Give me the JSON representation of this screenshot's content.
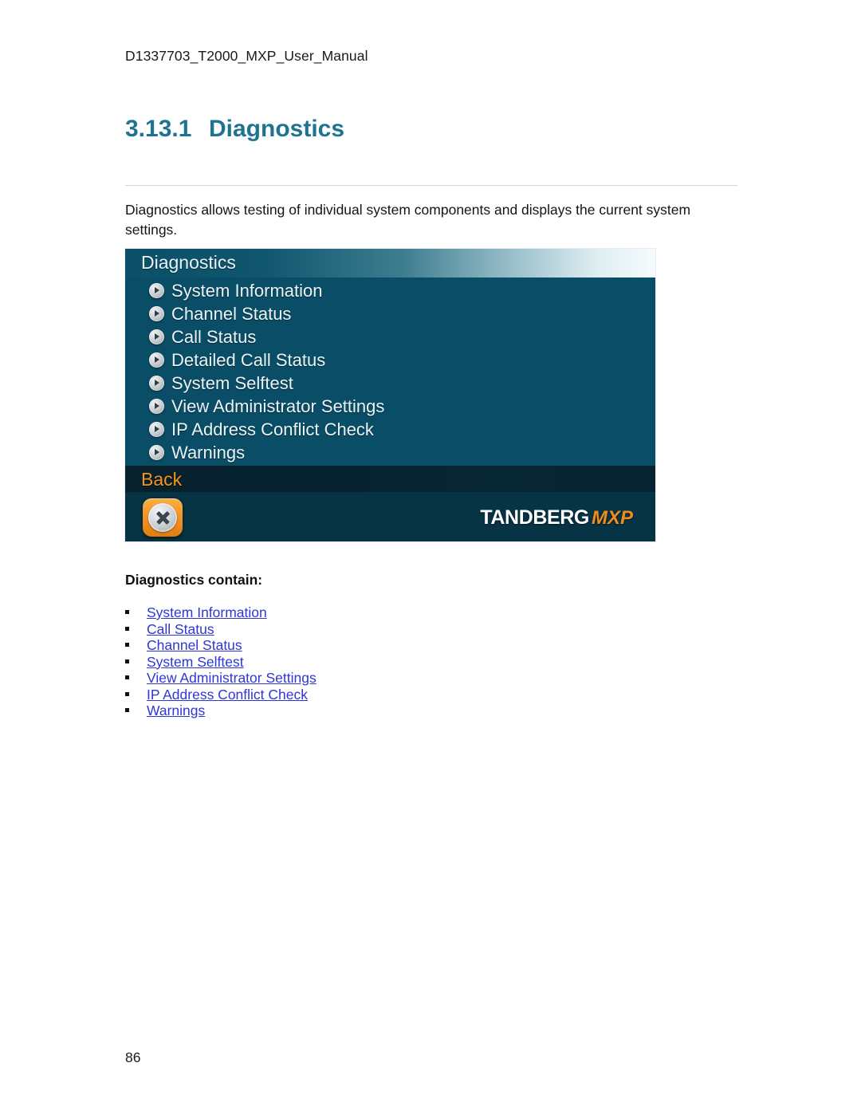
{
  "document": {
    "running_header": "D1337703_T2000_MXP_User_Manual",
    "page_number": "86"
  },
  "section": {
    "number": "3.13.1",
    "title": "Diagnostics",
    "heading_color": "#1e7490",
    "intro": "Diagnostics allows testing of individual system components and displays the current system settings."
  },
  "screenshot": {
    "title": "Diagnostics",
    "background_color": "#0a4d66",
    "menu_items": [
      {
        "label": "System Information",
        "icon": "play-circle-icon"
      },
      {
        "label": "Channel Status",
        "icon": "play-circle-icon"
      },
      {
        "label": "Call Status",
        "icon": "play-circle-icon"
      },
      {
        "label": "Detailed Call Status",
        "icon": "play-circle-icon"
      },
      {
        "label": "System Selftest",
        "icon": "play-circle-icon"
      },
      {
        "label": "View Administrator Settings",
        "icon": "play-circle-icon"
      },
      {
        "label": "IP Address Conflict Check",
        "icon": "play-circle-icon"
      },
      {
        "label": "Warnings",
        "icon": "play-circle-icon"
      }
    ],
    "back": {
      "label": "Back",
      "label_color": "#f39320",
      "button_icon": "close-x-icon"
    },
    "brand": {
      "name": "TANDBERG",
      "suffix": "MXP",
      "suffix_color": "#f08b1d"
    }
  },
  "contains": {
    "heading": "Diagnostics contain:",
    "link_color": "#2f36d6",
    "links": [
      "System Information",
      "Call Status",
      "Channel Status",
      "System Selftest",
      "View Administrator Settings",
      "IP Address Conflict Check",
      "Warnings"
    ]
  }
}
